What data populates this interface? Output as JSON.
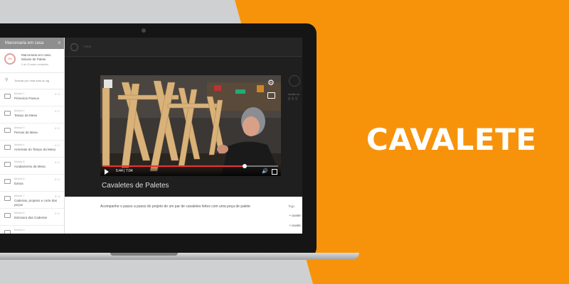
{
  "promo": {
    "headline": "CAVALETE"
  },
  "sidebar": {
    "header_title": "Marcenaria em casa",
    "menu_icon": "≡",
    "course": {
      "progress_text": "0%",
      "title_line1": "Marcenaria em casa:",
      "title_line2": "Móveis de Palete",
      "subtitle": "0 de 20 aulas completas"
    },
    "search_placeholder": "Buscar por uma aula ou ag",
    "modules": [
      {
        "label": "Módulo 1",
        "title": "Primeiros Passos",
        "count": "0 / 3"
      },
      {
        "label": "Módulo 2",
        "title": "Tampo da Mesa",
        "count": "0 / 2"
      },
      {
        "label": "Módulo 3",
        "title": "Pernas da Mesa",
        "count": "0 / 2"
      },
      {
        "label": "Módulo 4",
        "title": "Arremate do Tampo da Mesa",
        "count": "0 / 1"
      },
      {
        "label": "Módulo 5",
        "title": "Acabamento da Mesa",
        "count": "0 / 1"
      },
      {
        "label": "Módulo 6",
        "title": "Extras",
        "count": "0 / 4"
      },
      {
        "label": "Módulo 7",
        "title": "Cadeiras, projetos e corte das peças",
        "count": "0 / 3"
      },
      {
        "label": "Módulo 8",
        "title": "Estrutura das Cadeiras",
        "count": "0 / 2"
      },
      {
        "label": "Módulo 9",
        "title": "",
        "count": ""
      }
    ]
  },
  "main": {
    "top_text": "Voltar",
    "video": {
      "current_time": "5:44",
      "duration": "7:04",
      "progress": 0.81
    },
    "right_label": "Avalie es",
    "right_num": "6 9 9",
    "video_title": "Cavaletes de Paletes",
    "description": "Acompanhe o passo a passo do projeto de um par de cavaletes feitos com uma peça de palete",
    "tags_label": "Tags",
    "tags": [
      "• cavale",
      "• cavale"
    ]
  },
  "colors": {
    "orange": "#f7930b",
    "grey": "#cfd0d1",
    "seek": "#ee3333"
  }
}
